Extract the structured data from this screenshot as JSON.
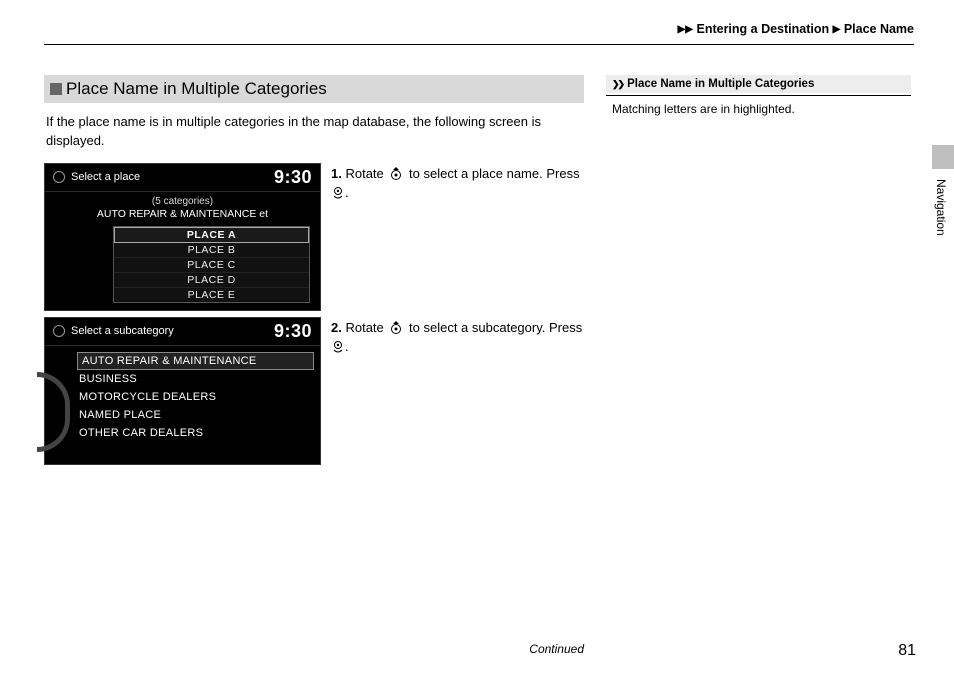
{
  "breadcrumb": {
    "a": "Entering a Destination",
    "b": "Place Name"
  },
  "title": "Place Name in Multiple Categories",
  "intro": "If the place name is in multiple categories in the map database, the following screen is displayed.",
  "screen1": {
    "header": "Select a place",
    "time": "9:30",
    "subSmall": "(5 categories)",
    "subBig": "AUTO REPAIR & MAINTENANCE et",
    "items": [
      "PLACE A",
      "PLACE B",
      "PLACE C",
      "PLACE D",
      "PLACE E"
    ]
  },
  "step1": {
    "num": "1.",
    "a": "Rotate",
    "b": "to select a place name.",
    "c": "Press",
    "d": "."
  },
  "screen2": {
    "header": "Select a subcategory",
    "time": "9:30",
    "items": [
      "AUTO REPAIR & MAINTENANCE",
      "BUSINESS",
      "MOTORCYCLE DEALERS",
      "NAMED PLACE",
      "OTHER CAR DEALERS"
    ]
  },
  "step2": {
    "num": "2.",
    "a": "Rotate",
    "b": "to select a subcategory.",
    "c": "Press",
    "d": "."
  },
  "side": {
    "title": "Place Name in Multiple Categories",
    "note": "Matching letters are in highlighted."
  },
  "continued": "Continued",
  "pageno": "81",
  "sideTab": "Navigation"
}
